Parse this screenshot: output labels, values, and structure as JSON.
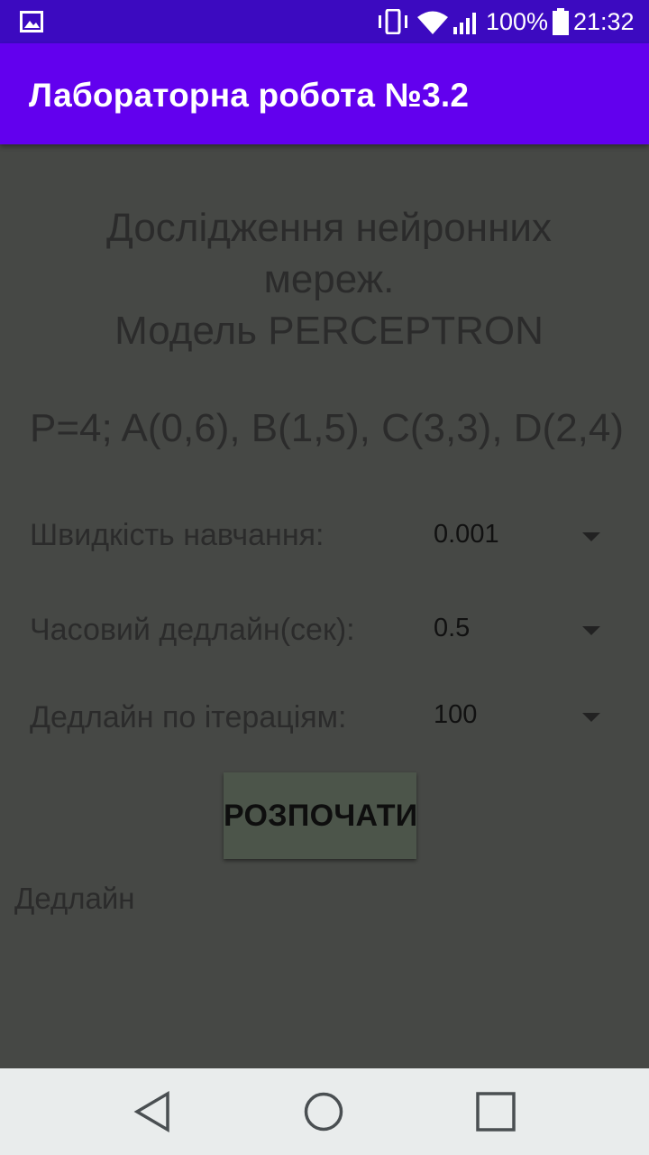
{
  "status_bar": {
    "battery_percent": "100%",
    "time": "21:32",
    "icons": [
      "image-icon",
      "vibrate-icon",
      "wifi-icon",
      "signal-icon",
      "battery-icon"
    ]
  },
  "app_bar": {
    "title": "Лабораторна робота №3.2",
    "color": "#6200ee"
  },
  "main": {
    "heading_lines": [
      "Дослідження нейронних",
      "мереж.",
      "Модель PERCEPTRON"
    ],
    "points": "P=4; A(0,6), B(1,5), C(3,3), D(2,4)",
    "params": [
      {
        "label": "Швидкість навчання:",
        "value": "0.001"
      },
      {
        "label": "Часовий дедлайн(сек):",
        "value": "0.5"
      },
      {
        "label": "Дедлайн по ітераціям:",
        "value": "100"
      }
    ],
    "start_button": "РОЗПОЧАТИ",
    "result_label": "Дедлайн"
  },
  "nav_bar": {
    "buttons": [
      "back-icon",
      "home-icon",
      "recents-icon"
    ]
  }
}
